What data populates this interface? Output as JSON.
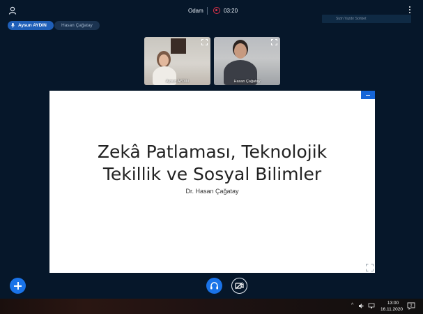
{
  "header": {
    "room_title": "Odam",
    "record_time": "03:20",
    "typing_placeholder": "Sizin Yazdır Sohbet"
  },
  "participants": [
    {
      "name": "Aysun AYDIN",
      "speaking": true
    },
    {
      "name": "Hasan Çağatay",
      "speaking": false
    }
  ],
  "video_tiles": [
    {
      "name": "Aysun AYDIN"
    },
    {
      "name": "Hasan Çağatay"
    }
  ],
  "presentation": {
    "title_line1": "Zekâ Patlaması, Teknolojik",
    "title_line2": "Tekillik ve Sosyal Bilimler",
    "author": "Dr. Hasan Çağatay"
  },
  "taskbar": {
    "time": "13:00",
    "date": "16.11.2020",
    "notification_count": "2"
  },
  "colors": {
    "background": "#06172a",
    "accent": "#1a73e8",
    "record": "#e0334a"
  }
}
